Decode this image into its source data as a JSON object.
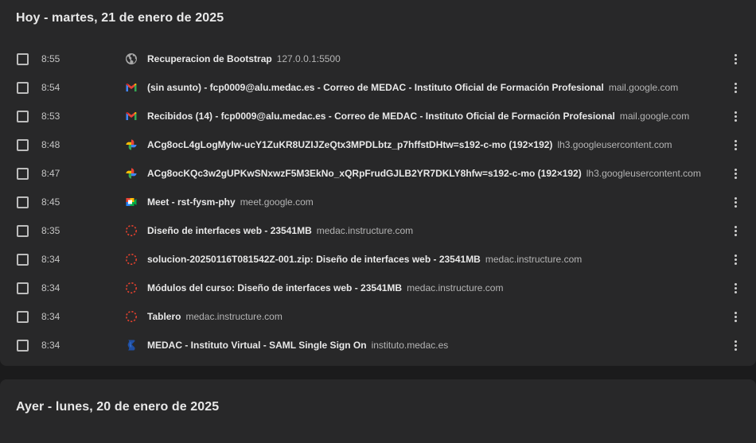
{
  "today": {
    "header": "Hoy - martes, 21 de enero de 2025",
    "items": [
      {
        "time": "8:55",
        "title": "Recuperacion de Bootstrap",
        "domain": "127.0.0.1:5500",
        "icon": "globe-icon"
      },
      {
        "time": "8:54",
        "title": "(sin asunto) - fcp0009@alu.medac.es - Correo de MEDAC - Instituto Oficial de Formación Profesional",
        "domain": "mail.google.com",
        "icon": "gmail-icon"
      },
      {
        "time": "8:53",
        "title": "Recibidos (14) - fcp0009@alu.medac.es - Correo de MEDAC - Instituto Oficial de Formación Profesional",
        "domain": "mail.google.com",
        "icon": "gmail-icon"
      },
      {
        "time": "8:48",
        "title": "ACg8ocL4gLogMyIw-ucY1ZuKR8UZIJZeQtx3MPDLbtz_p7hffstDHtw=s192-c-mo (192×192)",
        "domain": "lh3.googleusercontent.com",
        "icon": "google-photos-icon"
      },
      {
        "time": "8:47",
        "title": "ACg8ocKQc3w2gUPKwSNxwzF5M3EkNo_xQRpFrudGJLB2YR7DKLY8hfw=s192-c-mo (192×192)",
        "domain": "lh3.googleusercontent.com",
        "icon": "google-photos-icon"
      },
      {
        "time": "8:45",
        "title": "Meet - rst-fysm-phy",
        "domain": "meet.google.com",
        "icon": "google-meet-icon"
      },
      {
        "time": "8:35",
        "title": "Diseño de interfaces web - 23541MB",
        "domain": "medac.instructure.com",
        "icon": "canvas-icon"
      },
      {
        "time": "8:34",
        "title": "solucion-20250116T081542Z-001.zip: Diseño de interfaces web - 23541MB",
        "domain": "medac.instructure.com",
        "icon": "canvas-icon"
      },
      {
        "time": "8:34",
        "title": "Módulos del curso: Diseño de interfaces web - 23541MB",
        "domain": "medac.instructure.com",
        "icon": "canvas-icon"
      },
      {
        "time": "8:34",
        "title": "Tablero",
        "domain": "medac.instructure.com",
        "icon": "canvas-icon"
      },
      {
        "time": "8:34",
        "title": "MEDAC - Instituto Virtual - SAML Single Sign On",
        "domain": "instituto.medac.es",
        "icon": "medac-icon"
      }
    ]
  },
  "yesterday": {
    "header": "Ayer - lunes, 20 de enero de 2025"
  },
  "colors": {
    "background": "#1b1b1c",
    "card": "#282829",
    "text": "#e8e8e8",
    "muted": "#b4b4b4",
    "canvas_red": "#e2412e",
    "medac_blue": "#1f4fa3"
  }
}
